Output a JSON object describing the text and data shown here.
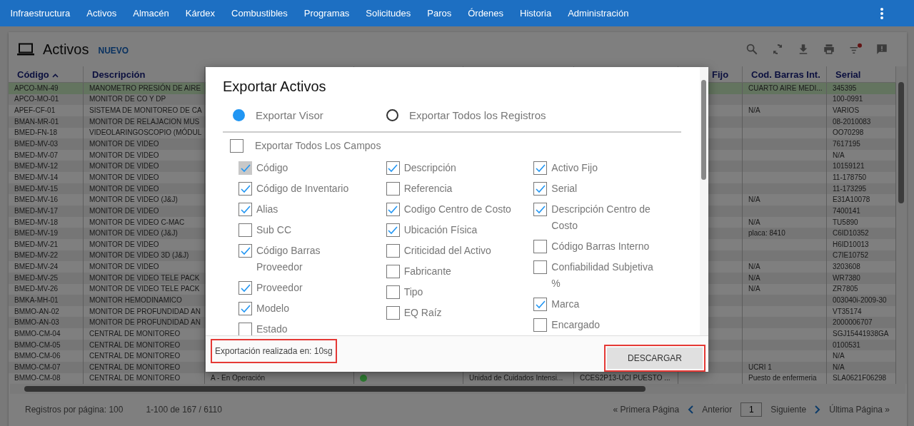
{
  "nav": {
    "items": [
      {
        "label": "Infraestructura",
        "selected": false
      },
      {
        "label": "Activos",
        "selected": false
      },
      {
        "label": "Almacén",
        "selected": false
      },
      {
        "label": "Kárdex",
        "selected": false
      },
      {
        "label": "Combustibles",
        "selected": false
      },
      {
        "label": "Programas",
        "selected": false
      },
      {
        "label": "Solicitudes",
        "selected": false
      },
      {
        "label": "Paros",
        "selected": false
      },
      {
        "label": "Órdenes",
        "selected": false
      },
      {
        "label": "Historia",
        "selected": false
      },
      {
        "label": "Administración",
        "selected": false
      }
    ]
  },
  "page": {
    "title": "Activos",
    "new_link": "NUEVO"
  },
  "table": {
    "columns": [
      {
        "label": "Código",
        "sorted": true
      },
      {
        "label": "Descripción",
        "sorted": false
      },
      {
        "label": "Fijo",
        "sorted": false
      },
      {
        "label": "Cod. Barras Int.",
        "sorted": false
      },
      {
        "label": "Serial",
        "sorted": false
      }
    ],
    "rows": [
      {
        "code": "APCO-MN-49",
        "description": "MANOMETRO PRESIÓN DE AIRE",
        "cod_barras_int": "CUARTO AIRE MEDI...",
        "serial": "345395",
        "selected": true
      },
      {
        "code": "APCO-MO-01",
        "description": "MONITOR DE CO Y DP",
        "serial": "100-0991",
        "selected": false
      },
      {
        "code": "APEF-CF-01",
        "description": "SISTEMA DE MONITOREO DE CA",
        "cod_barras_int": "N/A",
        "serial": "VARIOS",
        "selected": false
      },
      {
        "code": "BMAN-MR-01",
        "description": "MONITOR DE RELAJACION MUS",
        "serial": "08-2010083",
        "selected": false
      },
      {
        "code": "BMED-FN-18",
        "description": "VIDEOLARINGOSCOPIO (MÓDUL",
        "serial": "OO70298",
        "selected": false
      },
      {
        "code": "BMED-MV-03",
        "description": "MONITOR DE VIDEO",
        "serial": "7617195",
        "selected": false
      },
      {
        "code": "BMED-MV-07",
        "description": "MONITOR DE VIDEO",
        "serial": "N/A",
        "selected": false
      },
      {
        "code": "BMED-MV-12",
        "description": "MONITOR DE VIDEO",
        "serial": "10159121",
        "selected": false
      },
      {
        "code": "BMED-MV-14",
        "description": "MONITOR DE VIDEO",
        "serial": "11-178750",
        "selected": false
      },
      {
        "code": "BMED-MV-15",
        "description": "MONITOR DE VIDEO",
        "serial": "11-173295",
        "selected": false
      },
      {
        "code": "BMED-MV-16",
        "description": "MONITOR DE VIDEO (J&J)",
        "cod_barras_int": "N/A",
        "serial": "E31A10078",
        "selected": false
      },
      {
        "code": "BMED-MV-17",
        "description": "MONITOR DE VIDEO",
        "serial": "7400141",
        "selected": false
      },
      {
        "code": "BMED-MV-18",
        "description": "MONITOR DE VIDEO C-MAC",
        "cod_barras_int": "N/A",
        "serial": "TU5890",
        "selected": false
      },
      {
        "code": "BMED-MV-19",
        "description": "MONITOR DE VIDEO (J&J)",
        "cod_barras_int": "placa: 8410",
        "serial": "C6ID10352",
        "selected": false
      },
      {
        "code": "BMED-MV-21",
        "description": "MONITOR DE VIDEO",
        "serial": "H6ID10013",
        "selected": false
      },
      {
        "code": "BMED-MV-22",
        "description": "MONITOR DE VIDEO 3D (J&J)",
        "serial": "C7IE10752",
        "selected": false
      },
      {
        "code": "BMED-MV-24",
        "description": "MONITOR DE VIDEO",
        "cod_barras_int": "N/A",
        "serial": "3203608",
        "selected": false
      },
      {
        "code": "BMED-MV-25",
        "description": "MONITOR DE VIDEO TELE PACK",
        "cod_barras_int": "N/A",
        "serial": "WR7380",
        "selected": false
      },
      {
        "code": "BMED-MV-26",
        "description": "MONITOR DE VIDEO TELE PACK",
        "cod_barras_int": "N/A",
        "serial": "ZR7805",
        "selected": false
      },
      {
        "code": "BMKA-MH-01",
        "description": "MONITOR HEMODINAMICO",
        "serial": "003040i-2009-30",
        "selected": false
      },
      {
        "code": "BMMO-AN-02",
        "description": "MONITOR DE PROFUNDIDAD AN",
        "serial": "VT35174",
        "selected": false
      },
      {
        "code": "BMMO-AN-03",
        "description": "MONITOR DE PROFUNDIDAD AN",
        "serial": "2000006707",
        "selected": false
      },
      {
        "code": "BMMO-CM-04",
        "description": "CENTRAL DE MONITOREO",
        "serial": "SGJ15441938GA",
        "selected": false
      },
      {
        "code": "BMMO-CM-05",
        "description": "CENTRAL DE MONITOREO",
        "serial": "0100531",
        "selected": false
      },
      {
        "code": "BMMO-CM-06",
        "description": "CENTRAL DE MONITOREO",
        "serial": "N/A",
        "selected": false
      },
      {
        "code": "BMMO-CM-07",
        "description": "CENTRAL DE MONITOREO",
        "cod_barras_int": "UCRI 1",
        "serial": "N/A",
        "selected": false
      },
      {
        "code": "BMMO-CM-08",
        "description": "CENTRAL DE MONITOREO",
        "column_3": "A - En Operación",
        "column_4": {
          "color": "#2e7d32"
        },
        "column_5": "Unidad de Cuidados Intensi...",
        "column_6": "CCES2P13-UCI PUESTO ...",
        "cod_barras_int": "Puesto de enfermeria",
        "serial": "SLA0621F06298",
        "selected": false
      }
    ]
  },
  "pagination": {
    "per_page": "Registros por página: 100",
    "range": "1-100 de 167 / 6110",
    "first": "« Primera Página",
    "previous": "Anterior",
    "page": "1",
    "next": "Siguiente",
    "last": "Última Página »"
  },
  "dialog": {
    "title": "Exportar Activos",
    "options": [
      {
        "label": "Exportar Visor",
        "selected": true
      },
      {
        "label": "Exportar Todos los Registros",
        "selected": false
      }
    ],
    "all_fields": {
      "label": "Exportar Todos Los Campos",
      "checked": false
    },
    "field_columns": [
      [
        {
          "label": "Código",
          "checked": true,
          "disabled": true
        },
        {
          "label": "Código de Inventario",
          "checked": true,
          "disabled": false
        },
        {
          "label": "Alias",
          "checked": true,
          "disabled": false
        },
        {
          "label": "Sub CC",
          "checked": false,
          "disabled": false
        },
        {
          "label": "Código Barras Proveedor",
          "checked": true,
          "disabled": false
        },
        {
          "label": "Proveedor",
          "checked": true,
          "disabled": false
        },
        {
          "label": "Modelo",
          "checked": true,
          "disabled": false
        },
        {
          "label": "Estado",
          "checked": false,
          "disabled": false
        }
      ],
      [
        {
          "label": "Descripción",
          "checked": true,
          "disabled": false
        },
        {
          "label": "Referencia",
          "checked": false,
          "disabled": false
        },
        {
          "label": "Codigo Centro de Costo",
          "checked": true,
          "disabled": false
        },
        {
          "label": "Ubicación Física",
          "checked": true,
          "disabled": false
        },
        {
          "label": "Criticidad del Activo",
          "checked": false,
          "disabled": false
        },
        {
          "label": "Fabricante",
          "checked": false,
          "disabled": false
        },
        {
          "label": "Tipo",
          "checked": false,
          "disabled": false
        },
        {
          "label": "EQ Raíz",
          "checked": false,
          "disabled": false
        }
      ],
      [
        {
          "label": "Activo Fijo",
          "checked": true,
          "disabled": false
        },
        {
          "label": "Serial",
          "checked": true,
          "disabled": false
        },
        {
          "label": "Descripción Centro de Costo",
          "checked": true,
          "disabled": false
        },
        {
          "label": "Código Barras Interno",
          "checked": false,
          "disabled": false
        },
        {
          "label": "Confiabilidad Subjetiva %",
          "checked": false,
          "disabled": false
        },
        {
          "label": "Marca",
          "checked": true,
          "disabled": false
        },
        {
          "label": "Encargado",
          "checked": false,
          "disabled": false
        }
      ]
    ],
    "status": "Exportación realizada en: 10sg",
    "download_button": "DESCARGAR"
  }
}
